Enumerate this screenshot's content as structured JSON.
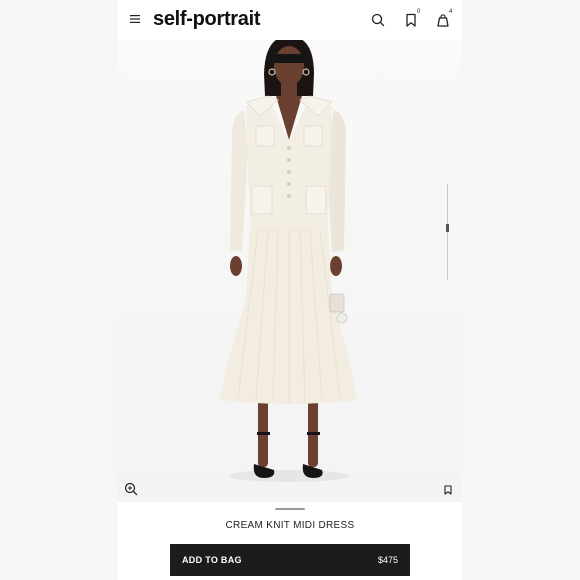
{
  "header": {
    "brand": "self-portrait",
    "wishlist_count": "0",
    "bag_count": "4",
    "icons": {
      "menu": "menu-icon",
      "search": "search-icon",
      "wishlist": "bookmark-icon",
      "bag": "bag-icon"
    }
  },
  "hero": {
    "image": "model-wearing-cream-knit-midi-dress",
    "icons": {
      "zoom": "zoom-in-icon",
      "save": "bookmark-icon"
    }
  },
  "product": {
    "name": "CREAM KNIT MIDI DRESS",
    "add_label": "ADD TO BAG",
    "price": "$475"
  },
  "colors": {
    "accent": "#1c1c1c",
    "dress": "#f3eee4",
    "skin": "#6b4030",
    "page_bg": "#f6f6f6"
  }
}
